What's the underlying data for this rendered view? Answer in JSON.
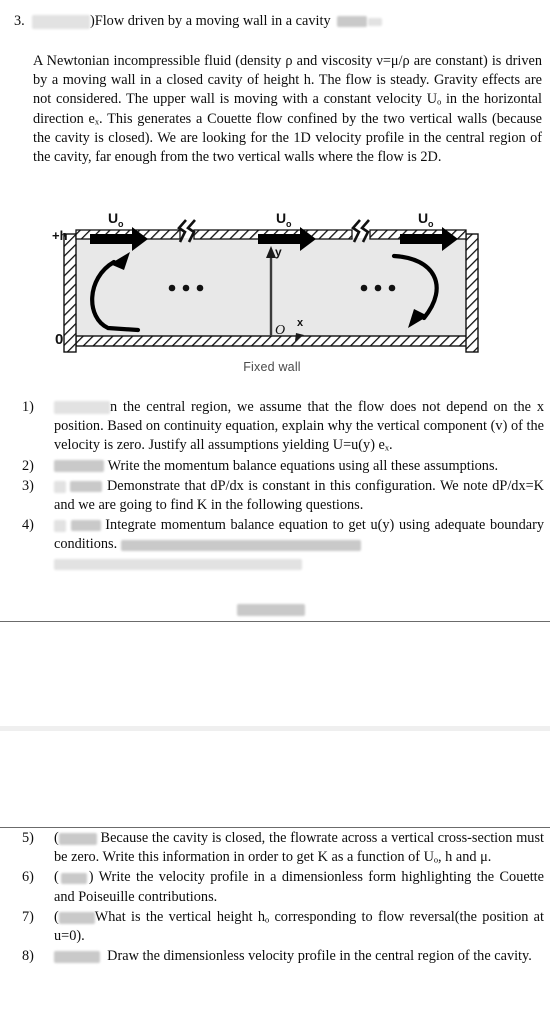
{
  "document": {
    "problem_number": "3.",
    "title_text": ")Flow driven by a moving wall in a cavity",
    "intro_paragraph": "A Newtonian incompressible fluid (density ρ and viscosity ν=μ/ρ are constant) is driven by a moving wall in a closed cavity of height h. The flow is steady. Gravity effects are not considered. The upper wall is moving with a constant velocity Uₒ in the horizontal direction eₓ. This generates a Couette flow confined by the two vertical walls (because the cavity is closed). We are looking for the 1D velocity profile in the central region of the cavity, far enough from the two vertical walls where the flow is 2D."
  },
  "figure": {
    "caption": "Fixed wall",
    "label_top": "+h",
    "label_bottom": "0",
    "label_origin": "O",
    "label_axis_y": "y",
    "label_axis_x": "x",
    "velocity_labels": [
      "Uₒ",
      "Uₒ",
      "Uₒ"
    ],
    "ellipsis_left": "• • •",
    "ellipsis_right": "• • •",
    "colors": {
      "fluid_fill": "#e8e8e8",
      "wall_line": "#111111",
      "arrow": "#000000",
      "caption_text": "#4a4a4a"
    }
  },
  "questions_top": [
    {
      "number": "1)",
      "text_before_redaction": "",
      "text": "n the central region, we assume that the flow does not depend on the x position. Based on continuity equation, explain why the vertical component (v) of the velocity is zero. Justify all assumptions yielding U=u(y) eₓ.",
      "lead_redaction_width": 56
    },
    {
      "number": "2)",
      "text": "Write the momentum balance equations using all these assumptions.",
      "lead_redaction_width": 50
    },
    {
      "number": "3)",
      "text": "Demonstrate that dP/dx is constant in this configuration. We note dP/dx=K and we are going to find K in the following questions.",
      "lead_redaction_width": 48
    },
    {
      "number": "4)",
      "text": "Integrate momentum balance equation to get u(y) using adequate boundary conditions.",
      "lead_redaction_width": 48
    }
  ],
  "questions_bottom": [
    {
      "number": "5)",
      "prefix": "(",
      "text": "Because the cavity is closed, the flowrate across a vertical cross-section must be zero. Write this information in order to get K as a function of Uₒ, h and μ.",
      "lead_redaction_width": 38
    },
    {
      "number": "6)",
      "prefix": "(",
      "suffix": ")",
      "text": "Write the velocity profile in a dimensionless form highlighting the Couette and Poiseuille contributions.",
      "lead_redaction_width": 30
    },
    {
      "number": "7)",
      "prefix": "(",
      "text": "What is the vertical height hₒ corresponding to flow reversal(the position at u=0).",
      "lead_redaction_width": 36
    },
    {
      "number": "8)",
      "text": "Draw the dimensionless velocity profile in the central region of the cavity.",
      "lead_redaction_width": 46
    }
  ],
  "redactions": {
    "title_block_width": 58,
    "title_trailing_block_width": 38,
    "item4_tail_lines": 2,
    "rule_block_width": 68
  }
}
